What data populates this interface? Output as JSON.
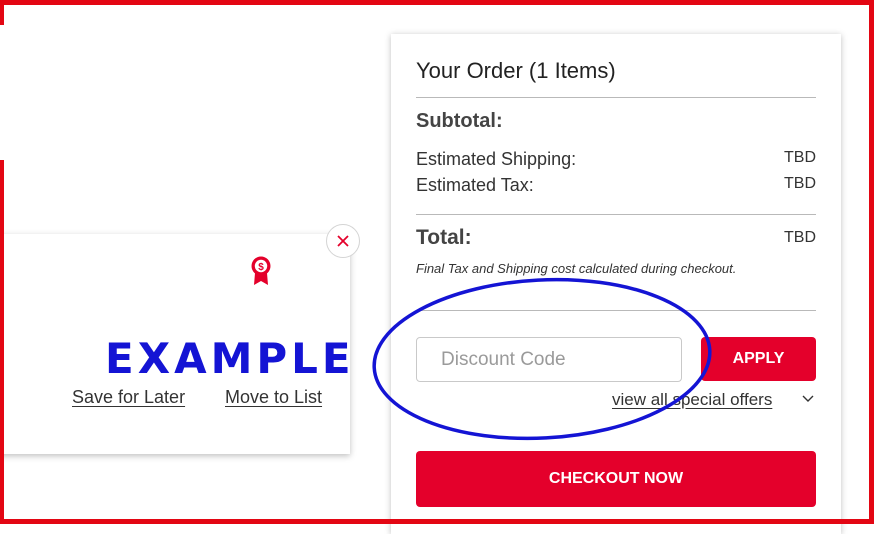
{
  "product_card": {
    "watermark_text": "EXAMPLE",
    "save_for_later_label": "Save for Later",
    "move_to_list_label": "Move to List",
    "close_icon": "close-x-icon",
    "badge_icon": "dollar-award-ribbon-icon"
  },
  "order": {
    "title": "Your Order (1 Items)",
    "subtotal_label": "Subtotal:",
    "shipping_label": "Estimated Shipping:",
    "shipping_value": "TBD",
    "tax_label": "Estimated Tax:",
    "tax_value": "TBD",
    "total_label": "Total:",
    "total_value": "TBD",
    "disclaimer": "Final Tax and Shipping cost calculated during checkout.",
    "discount_placeholder": "Discount Code",
    "apply_label": "APPLY",
    "offers_label": "view all special offers",
    "checkout_label": "CHECKOUT NOW"
  },
  "colors": {
    "brand_red": "#e4002b",
    "frame_red": "#e30613",
    "annotation_blue": "#1414d4"
  }
}
